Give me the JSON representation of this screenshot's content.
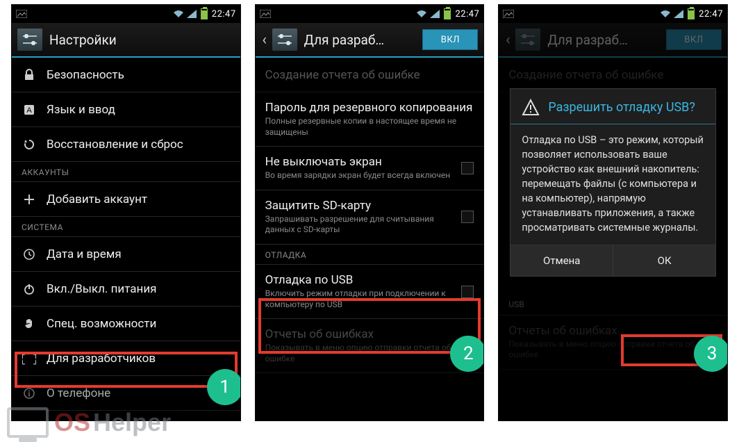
{
  "status": {
    "time": "22:47"
  },
  "screen1": {
    "title": "Настройки",
    "items": [
      {
        "icon": "lock",
        "label": "Безопасность"
      },
      {
        "icon": "lang",
        "label": "Язык и ввод"
      },
      {
        "icon": "restore",
        "label": "Восстановление и сброс"
      }
    ],
    "section_accounts": "АККАУНТЫ",
    "add_account": "Добавить аккаунт",
    "section_system": "СИСТЕМА",
    "system_items": [
      {
        "icon": "clock",
        "label": "Дата и время"
      },
      {
        "icon": "power",
        "label": "Вкл./Выкл. питания"
      },
      {
        "icon": "hand",
        "label": "Спец. возможности"
      },
      {
        "icon": "braces",
        "label": "Для разработчиков"
      },
      {
        "icon": "info",
        "label": "О телефоне"
      }
    ],
    "step": "1"
  },
  "screen2": {
    "title": "Для разраб…",
    "toggle": "ВКЛ",
    "bugreport": "Создание отчета об ошибке",
    "items": [
      {
        "title": "Пароль для резервного копирования",
        "sub": "Полные резервные копии в настоящее время не защищены"
      },
      {
        "title": "Не выключать экран",
        "sub": "Во время зарядки экран будет всегда включен",
        "checkbox": true
      },
      {
        "title": "Защитить SD-карту",
        "sub": "Запрашивать разрешение для считывания данных с SD-карты",
        "checkbox": true
      }
    ],
    "section_debug": "ОТЛАДКА",
    "usb_debug": {
      "title": "Отладка по USB",
      "sub": "Включить режим отладки при подключении к компьютеру по USB",
      "checkbox": true
    },
    "bug_reports": {
      "title": "Отчеты об ошибках",
      "sub": "Показывать в меню опцию отправки отчета об ошибке"
    },
    "step": "2"
  },
  "screen3": {
    "title": "Для разраб…",
    "toggle": "ВКЛ",
    "bugreport": "Создание отчета об ошибке",
    "usb_label": "USB",
    "bug_reports": {
      "title": "Отчеты об ошибках",
      "sub": "Показывать в меню опцию отправки отчета об ошибке"
    },
    "dialog": {
      "title": "Разрешить отладку USB?",
      "body": "Отладка по USB – это режим, который позволяет использовать ваше устройство как внешний накопитель: перемещать файлы (с компьютера и на компьютер), напрямую устанавливать приложения, а также просматривать системные журналы.",
      "cancel": "Отмена",
      "ok": "ОК"
    },
    "step": "3"
  },
  "watermark": {
    "os": "OS",
    "rest": "Helper"
  }
}
